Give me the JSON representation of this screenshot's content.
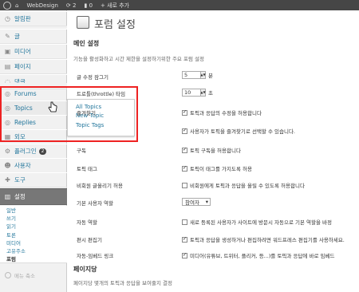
{
  "adminbar": {
    "site_name": "WebDesign",
    "updates_count": "2",
    "comments_count": "0",
    "new_label": "+ 새로 추가"
  },
  "sidebar": {
    "items": [
      {
        "label": "알림판",
        "icon": "dashboard-icon"
      },
      {
        "label": "글",
        "icon": "pin-icon"
      },
      {
        "label": "미디어",
        "icon": "media-icon"
      },
      {
        "label": "페이지",
        "icon": "page-icon"
      },
      {
        "label": "댓글",
        "icon": "comment-icon"
      },
      {
        "label": "Forums",
        "icon": "forums-icon"
      },
      {
        "label": "Topics",
        "icon": "topics-icon"
      },
      {
        "label": "Replies",
        "icon": "replies-icon"
      },
      {
        "label": "외모",
        "icon": "appearance-icon"
      },
      {
        "label": "플러그인",
        "icon": "plugin-icon",
        "badge": "2"
      },
      {
        "label": "사용자",
        "icon": "users-icon"
      },
      {
        "label": "도구",
        "icon": "tools-icon"
      },
      {
        "label": "설정",
        "icon": "settings-icon"
      }
    ],
    "submenu": [
      "일반",
      "쓰기",
      "읽기",
      "토론",
      "미디어",
      "고유주소",
      "포럼"
    ],
    "collapse_label": "메뉴 축소"
  },
  "flyout": {
    "items": [
      "All Topics",
      "New Topic",
      "Topic Tags"
    ]
  },
  "main": {
    "page_title": "포럼 설정",
    "section_main": "메인 설정",
    "section_main_desc": "기능을 활성화하고 시간 제한을 설정하기위한 주요 포럼 설정",
    "rows": [
      {
        "label": "글 수정 잠그기",
        "value": "5",
        "unit": "분"
      },
      {
        "label": "트로틀(throttle) 타임",
        "value": "10",
        "unit": "초"
      },
      {
        "label": "즐겨찾기",
        "checked": true,
        "text": "토픽과 응답의 수정을 허용합니다"
      },
      {
        "label": "",
        "checked": true,
        "text": "사용자가 토픽을 즐겨찾기로 선택할 수 있습니다."
      },
      {
        "label": "구독",
        "checked": true,
        "text": "토픽 구독을 허용합니다"
      },
      {
        "label": "토픽 태그",
        "checked": true,
        "text": "토픽이 태그를 가지도록 허용"
      },
      {
        "label": "비회원 글올리기 허용",
        "checked": false,
        "text": "비회원에게 토픽과 응답을 올릴 수 있도록 허용합니다"
      },
      {
        "label": "기본 사용자 역할",
        "select": "참여자"
      },
      {
        "label": "자동 역할",
        "checked": false,
        "text": "새로 등록된 사용자가 사이트에 방문시 자동으로 기본 역할을 바정"
      },
      {
        "label": "편시 편집기",
        "checked": true,
        "text": "토픽과 응답을 생성하거나 편집하려면 워드프레스 편집기를 사용하세요."
      },
      {
        "label": "자동-임베드 링크",
        "checked": true,
        "text": "미디어(유튜브, 트위터, 플리커, 등...)를 토픽과 응답에 바로 임베드"
      }
    ],
    "section_paging": "페이지당",
    "section_paging_desc": "페이지당 몇개의 토픽과 응답을 보여줄지 결정"
  }
}
